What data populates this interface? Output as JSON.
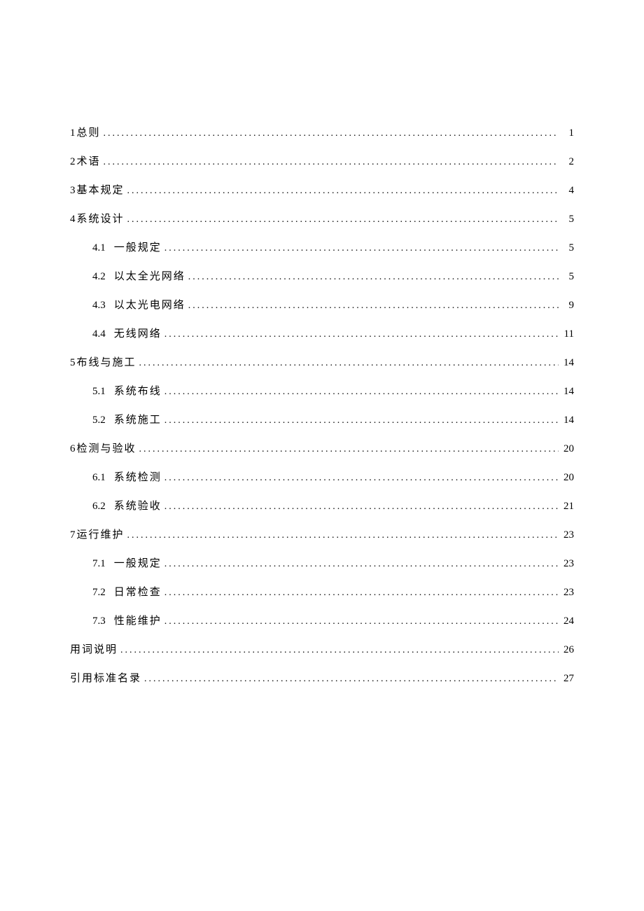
{
  "toc": [
    {
      "level": 1,
      "number": "1",
      "title": "总则",
      "page": "1"
    },
    {
      "level": 1,
      "number": "2",
      "title": "术语",
      "page": "2"
    },
    {
      "level": 1,
      "number": "3",
      "title": "基本规定",
      "page": "4"
    },
    {
      "level": 1,
      "number": "4",
      "title": "系统设计",
      "page": "5"
    },
    {
      "level": 2,
      "number": "4.1",
      "title": "一般规定",
      "page": "5"
    },
    {
      "level": 2,
      "number": "4.2",
      "title": "以太全光网络",
      "page": "5"
    },
    {
      "level": 2,
      "number": "4.3",
      "title": "以太光电网络",
      "page": "9"
    },
    {
      "level": 2,
      "number": "4.4",
      "title": "无线网络",
      "page": "11"
    },
    {
      "level": 1,
      "number": "5",
      "title": "布线与施工",
      "page": "14"
    },
    {
      "level": 2,
      "number": "5.1",
      "title": "系统布线",
      "page": "14"
    },
    {
      "level": 2,
      "number": "5.2",
      "title": "系统施工",
      "page": "14"
    },
    {
      "level": 1,
      "number": "6",
      "title": "检测与验收",
      "page": "20"
    },
    {
      "level": 2,
      "number": "6.1",
      "title": "系统检测",
      "page": "20"
    },
    {
      "level": 2,
      "number": "6.2",
      "title": "系统验收",
      "page": "21"
    },
    {
      "level": 1,
      "number": "7",
      "title": "运行维护",
      "page": "23"
    },
    {
      "level": 2,
      "number": "7.1",
      "title": "一般规定",
      "page": "23"
    },
    {
      "level": 2,
      "number": "7.2",
      "title": "日常检查",
      "page": "23"
    },
    {
      "level": 2,
      "number": "7.3",
      "title": "性能维护",
      "page": "24"
    },
    {
      "level": 1,
      "number": "",
      "title": "用词说明",
      "page": "26"
    },
    {
      "level": 1,
      "number": "",
      "title": "引用标准名录",
      "page": "27"
    }
  ]
}
